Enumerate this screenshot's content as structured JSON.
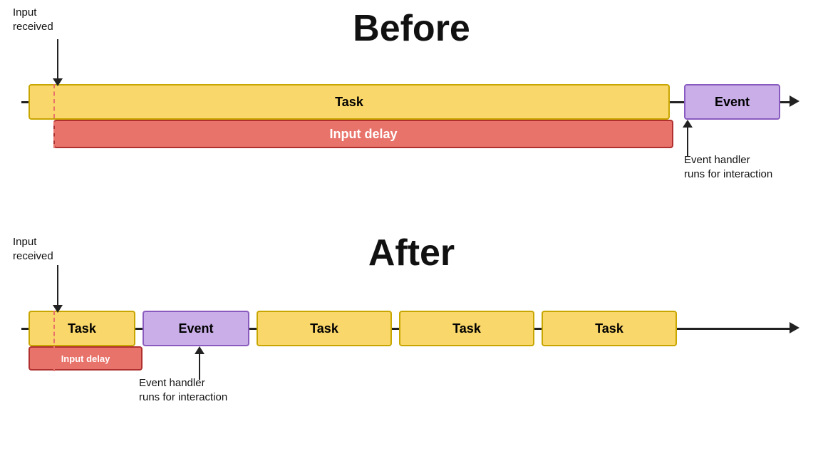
{
  "before": {
    "title": "Before",
    "input_received_label": "Input\nreceived",
    "task_label": "Task",
    "event_label": "Event",
    "input_delay_label": "Input delay",
    "event_handler_label": "Event handler\nruns for interaction"
  },
  "after": {
    "title": "After",
    "input_received_label": "Input\nreceived",
    "task_label_1": "Task",
    "event_label": "Event",
    "task_label_2": "Task",
    "task_label_3": "Task",
    "task_label_4": "Task",
    "input_delay_label": "Input delay",
    "event_handler_label": "Event handler\nruns for interaction"
  }
}
